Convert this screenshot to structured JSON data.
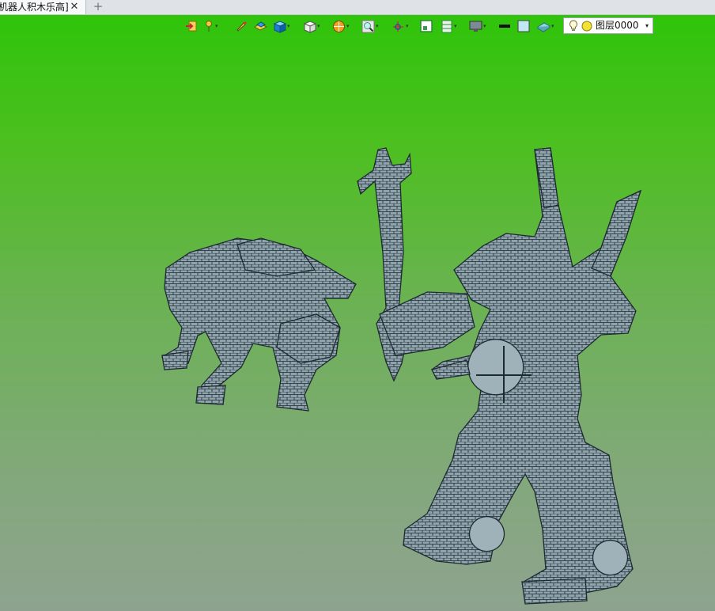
{
  "tab": {
    "title": "机器人积木乐高]",
    "close_glyph": "✕",
    "add_glyph": "+"
  },
  "toolbar": {
    "dropdown_glyph": "▾",
    "tools": [
      "import-icon",
      "pin-icon",
      "brush-icon",
      "blocks-icon",
      "solid-cube-icon",
      "wire-cube-icon",
      "sphere-icon",
      "zoom-icon",
      "axes-icon",
      "frame-icon",
      "panel-icon",
      "monitor-icon",
      "line-icon",
      "color-square-icon",
      "plane-icon"
    ],
    "layer_select": {
      "value": "图层0000",
      "caret": "▾"
    }
  },
  "colors": {
    "viewport_top": "#2fc40a",
    "viewport_bottom": "#8ea38f",
    "model_fill": "#8fa3ad",
    "model_edge": "#1d2a30"
  }
}
